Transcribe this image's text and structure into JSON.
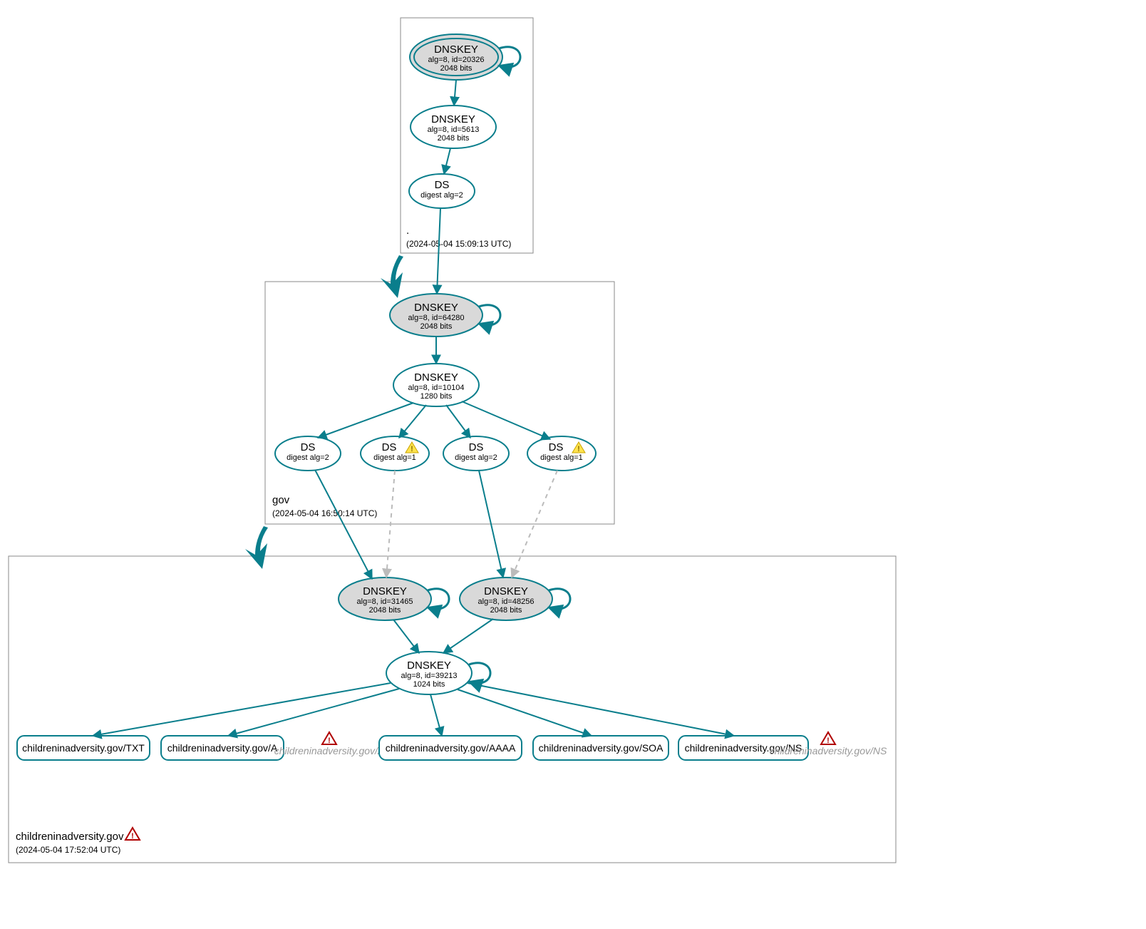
{
  "colors": {
    "accent": "#0a7e8c",
    "warn": "#ffe34d",
    "error": "#b00000",
    "grey": "#d9d9d9"
  },
  "zones": {
    "root": {
      "label": ".",
      "timestamp": "(2024-05-04 15:09:13 UTC)"
    },
    "gov": {
      "label": "gov",
      "timestamp": "(2024-05-04 16:50:14 UTC)"
    },
    "domain": {
      "label": "childreninadversity.gov",
      "timestamp": "(2024-05-04 17:52:04 UTC)",
      "has_error": true
    }
  },
  "nodes": {
    "root_ksk": {
      "title": "DNSKEY",
      "l1": "alg=8, id=20326",
      "l2": "2048 bits"
    },
    "root_zsk": {
      "title": "DNSKEY",
      "l1": "alg=8, id=5613",
      "l2": "2048 bits"
    },
    "root_ds": {
      "title": "DS",
      "l1": "digest alg=2",
      "l2": ""
    },
    "gov_ksk": {
      "title": "DNSKEY",
      "l1": "alg=8, id=64280",
      "l2": "2048 bits"
    },
    "gov_zsk": {
      "title": "DNSKEY",
      "l1": "alg=8, id=10104",
      "l2": "1280 bits"
    },
    "gov_ds1": {
      "title": "DS",
      "l1": "digest alg=2",
      "l2": ""
    },
    "gov_ds2": {
      "title": "DS",
      "l1": "digest alg=1",
      "l2": "",
      "warn": true
    },
    "gov_ds3": {
      "title": "DS",
      "l1": "digest alg=2",
      "l2": ""
    },
    "gov_ds4": {
      "title": "DS",
      "l1": "digest alg=1",
      "l2": "",
      "warn": true
    },
    "dom_ksk1": {
      "title": "DNSKEY",
      "l1": "alg=8, id=31465",
      "l2": "2048 bits"
    },
    "dom_ksk2": {
      "title": "DNSKEY",
      "l1": "alg=8, id=48256",
      "l2": "2048 bits"
    },
    "dom_zsk": {
      "title": "DNSKEY",
      "l1": "alg=8, id=39213",
      "l2": "1024 bits"
    }
  },
  "rrsets": {
    "txt": {
      "label": "childreninadversity.gov/TXT"
    },
    "a": {
      "label": "childreninadversity.gov/A"
    },
    "a_err": {
      "label": "childreninadversity.gov/A"
    },
    "aaaa": {
      "label": "childreninadversity.gov/AAAA"
    },
    "soa": {
      "label": "childreninadversity.gov/SOA"
    },
    "ns": {
      "label": "childreninadversity.gov/NS"
    },
    "ns_err": {
      "label": "childreninadversity.gov/NS"
    }
  }
}
